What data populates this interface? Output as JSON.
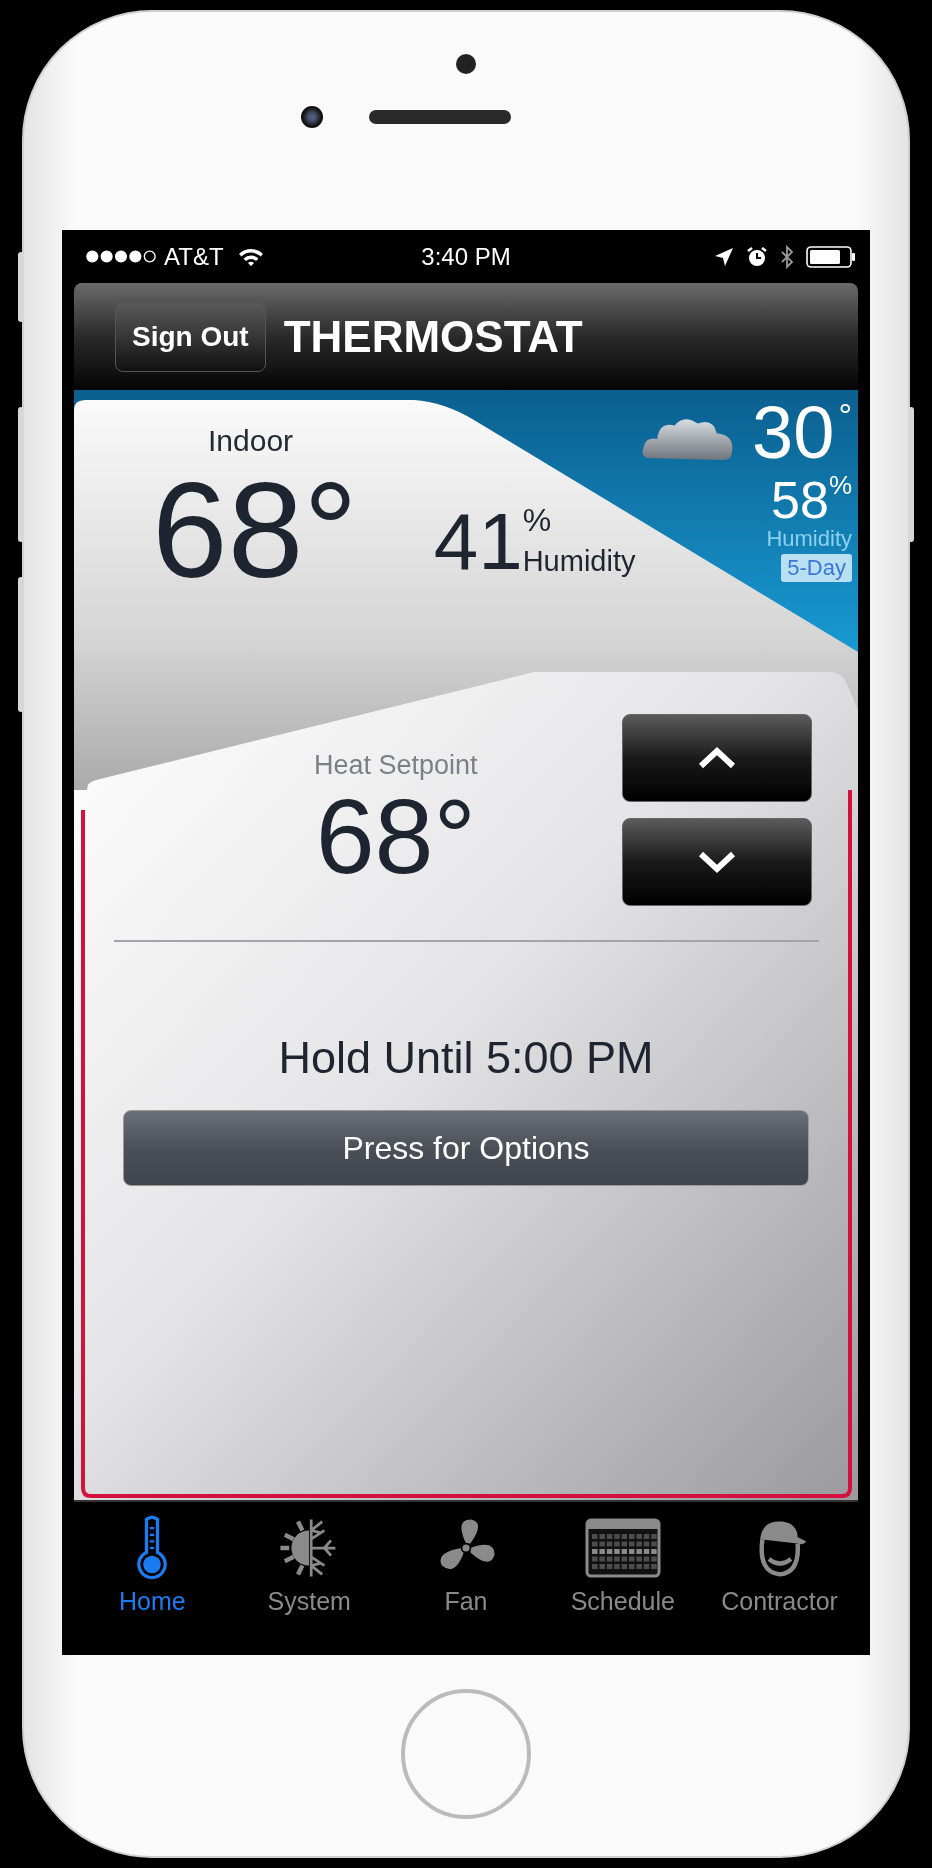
{
  "status_bar": {
    "carrier": "AT&T",
    "time": "3:40 PM"
  },
  "header": {
    "sign_out": "Sign Out",
    "title": "THERMOSTAT"
  },
  "indoor": {
    "label": "Indoor",
    "temperature": "68°",
    "humidity": "41",
    "humidity_unit": "%",
    "humidity_label": "Humidity"
  },
  "outdoor": {
    "temperature": "30",
    "degree": "°",
    "humidity": "58",
    "humidity_unit": "%",
    "humidity_label": "Humidity",
    "forecast_button": "5-Day"
  },
  "setpoint": {
    "label": "Heat Setpoint",
    "value": "68°"
  },
  "hold": {
    "text": "Hold Until 5:00 PM",
    "options_button": "Press for Options"
  },
  "tabs": [
    {
      "label": "Home",
      "selected": true
    },
    {
      "label": "System",
      "selected": false
    },
    {
      "label": "Fan",
      "selected": false
    },
    {
      "label": "Schedule",
      "selected": false
    },
    {
      "label": "Contractor",
      "selected": false
    }
  ]
}
